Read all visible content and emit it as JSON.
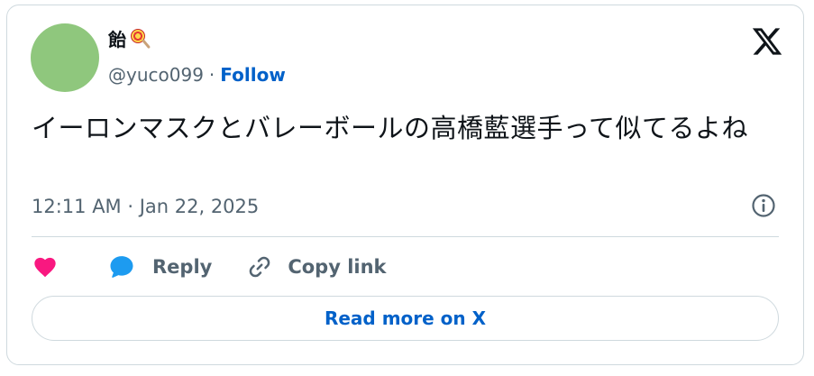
{
  "user": {
    "display_name": "飴",
    "emoji": "lollipop-emoji",
    "handle": "@yuco099",
    "separator": "·",
    "follow_label": "Follow"
  },
  "tweet": {
    "text": "イーロンマスクとバレーボールの高橋藍選手って似てるよね",
    "timestamp": "12:11 AM · Jan 22, 2025"
  },
  "actions": {
    "like_icon": "heart-icon",
    "reply_label": "Reply",
    "copy_link_label": "Copy link"
  },
  "read_more_label": "Read more on X",
  "colors": {
    "accent": "#0061c9",
    "heart": "#f91880",
    "reply_bubble": "#1d9bf0",
    "muted": "#536471",
    "text": "#0f1419",
    "border": "#cfd9de",
    "avatar": "#8fc77d"
  }
}
